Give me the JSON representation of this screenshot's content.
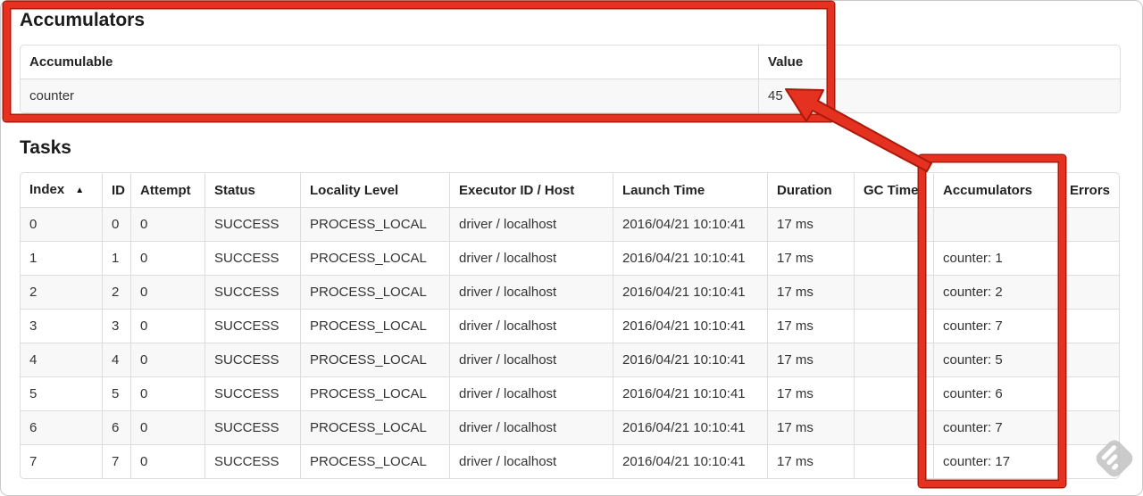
{
  "page": {
    "accumulators_section": {
      "title": "Accumulators",
      "table": {
        "headers": [
          "Accumulable",
          "Value"
        ],
        "rows": [
          {
            "accumulable": "counter",
            "value": "45"
          }
        ]
      }
    },
    "tasks_section": {
      "title": "Tasks",
      "table": {
        "sort_icon": "▲",
        "sorted_column": "Index",
        "headers": [
          "Index",
          "ID",
          "Attempt",
          "Status",
          "Locality Level",
          "Executor ID / Host",
          "Launch Time",
          "Duration",
          "GC Time",
          "Accumulators",
          "Errors"
        ],
        "column_keys": [
          "index",
          "id",
          "attempt",
          "status",
          "locality",
          "executor",
          "launch",
          "duration",
          "gc",
          "accumulators",
          "errors"
        ],
        "rows": [
          {
            "index": "0",
            "id": "0",
            "attempt": "0",
            "status": "SUCCESS",
            "locality": "PROCESS_LOCAL",
            "executor": "driver / localhost",
            "launch": "2016/04/21 10:10:41",
            "duration": "17 ms",
            "gc": "",
            "accumulators": "",
            "errors": ""
          },
          {
            "index": "1",
            "id": "1",
            "attempt": "0",
            "status": "SUCCESS",
            "locality": "PROCESS_LOCAL",
            "executor": "driver / localhost",
            "launch": "2016/04/21 10:10:41",
            "duration": "17 ms",
            "gc": "",
            "accumulators": "counter: 1",
            "errors": ""
          },
          {
            "index": "2",
            "id": "2",
            "attempt": "0",
            "status": "SUCCESS",
            "locality": "PROCESS_LOCAL",
            "executor": "driver / localhost",
            "launch": "2016/04/21 10:10:41",
            "duration": "17 ms",
            "gc": "",
            "accumulators": "counter: 2",
            "errors": ""
          },
          {
            "index": "3",
            "id": "3",
            "attempt": "0",
            "status": "SUCCESS",
            "locality": "PROCESS_LOCAL",
            "executor": "driver / localhost",
            "launch": "2016/04/21 10:10:41",
            "duration": "17 ms",
            "gc": "",
            "accumulators": "counter: 7",
            "errors": ""
          },
          {
            "index": "4",
            "id": "4",
            "attempt": "0",
            "status": "SUCCESS",
            "locality": "PROCESS_LOCAL",
            "executor": "driver / localhost",
            "launch": "2016/04/21 10:10:41",
            "duration": "17 ms",
            "gc": "",
            "accumulators": "counter: 5",
            "errors": ""
          },
          {
            "index": "5",
            "id": "5",
            "attempt": "0",
            "status": "SUCCESS",
            "locality": "PROCESS_LOCAL",
            "executor": "driver / localhost",
            "launch": "2016/04/21 10:10:41",
            "duration": "17 ms",
            "gc": "",
            "accumulators": "counter: 6",
            "errors": ""
          },
          {
            "index": "6",
            "id": "6",
            "attempt": "0",
            "status": "SUCCESS",
            "locality": "PROCESS_LOCAL",
            "executor": "driver / localhost",
            "launch": "2016/04/21 10:10:41",
            "duration": "17 ms",
            "gc": "",
            "accumulators": "counter: 7",
            "errors": ""
          },
          {
            "index": "7",
            "id": "7",
            "attempt": "0",
            "status": "SUCCESS",
            "locality": "PROCESS_LOCAL",
            "executor": "driver / localhost",
            "launch": "2016/04/21 10:10:41",
            "duration": "17 ms",
            "gc": "",
            "accumulators": "counter: 17",
            "errors": ""
          }
        ]
      }
    },
    "annotations": {
      "highlight_color": "#e53120",
      "highlight_outline_color": "#aa1a0a",
      "watermark_icon": "skitch-feather-logo",
      "watermark_color": "#c0c0c0"
    }
  }
}
